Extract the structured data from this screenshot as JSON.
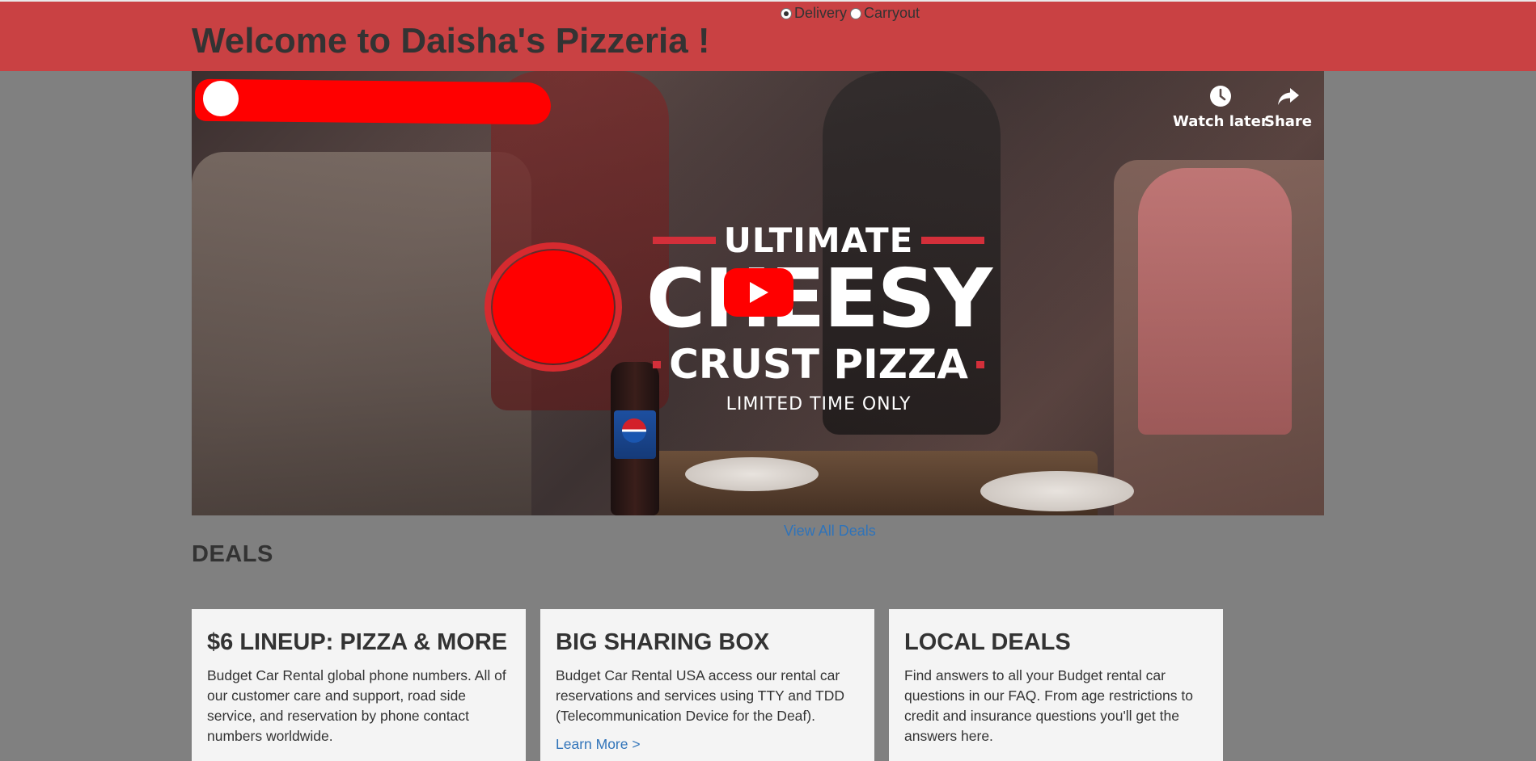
{
  "header": {
    "title": "Welcome to Daisha's Pizzeria !",
    "order_type": {
      "options": [
        {
          "label": "Delivery",
          "selected": true
        },
        {
          "label": "Carryout",
          "selected": false
        }
      ]
    },
    "background_color": "#c94143"
  },
  "video": {
    "actions": [
      {
        "label": "Watch later",
        "icon": "clock-icon"
      },
      {
        "label": "Share",
        "icon": "share-icon"
      }
    ],
    "promo": {
      "line1": "ULTIMATE",
      "line2": "CHEESY",
      "line3": "CRUST PIZZA",
      "line4": "LIMITED TIME ONLY"
    },
    "play_icon": "play-icon"
  },
  "view_all_deals": "View All Deals",
  "deals": {
    "heading": "DEALS",
    "cards": [
      {
        "title": "$6 LINEUP: PIZZA & MORE",
        "text": "Budget Car Rental global phone numbers. All of our customer care and support, road side service, and reservation by phone contact numbers worldwide."
      },
      {
        "title": "BIG SHARING BOX",
        "text": "Budget Car Rental USA access our rental car reservations and services using TTY and TDD (Telecommunication Device for the Deaf).",
        "link": "Learn More >"
      },
      {
        "title": "LOCAL DEALS",
        "text": "Find answers to all your Budget rental car questions in our FAQ. From age restrictions to credit and insurance questions you'll get the answers here."
      }
    ]
  }
}
